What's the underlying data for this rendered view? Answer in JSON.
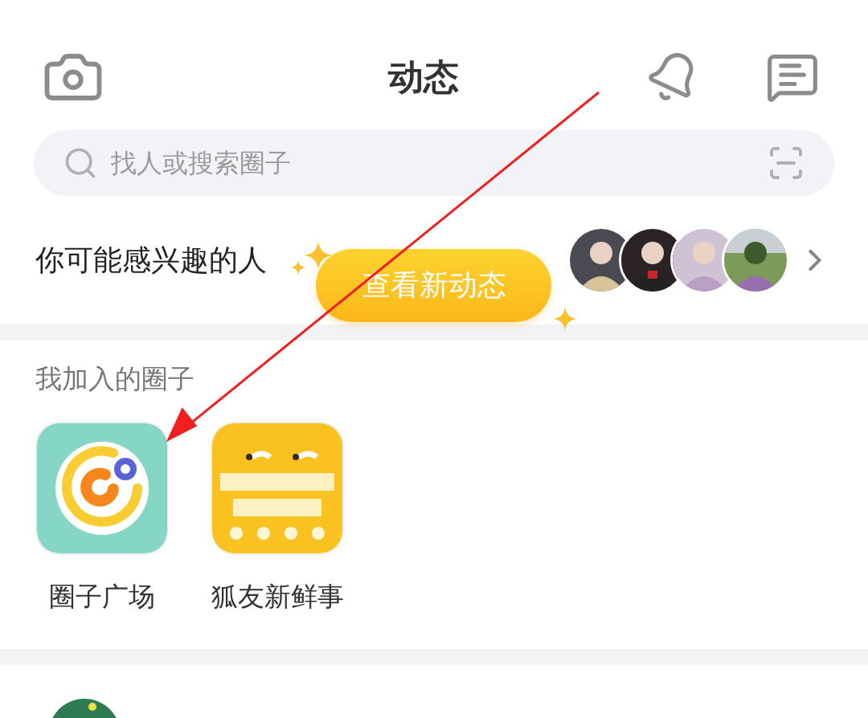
{
  "header": {
    "title": "动态"
  },
  "search": {
    "placeholder": "找人或搜索圈子"
  },
  "suggestions": {
    "title": "你可能感兴趣的人"
  },
  "new_posts_button": {
    "label": "查看新动态"
  },
  "my_circles": {
    "title": "我加入的圈子",
    "items": [
      {
        "name": "圈子广场",
        "kind": "logo"
      },
      {
        "name": "狐友新鲜事",
        "kind": "picture"
      }
    ]
  }
}
